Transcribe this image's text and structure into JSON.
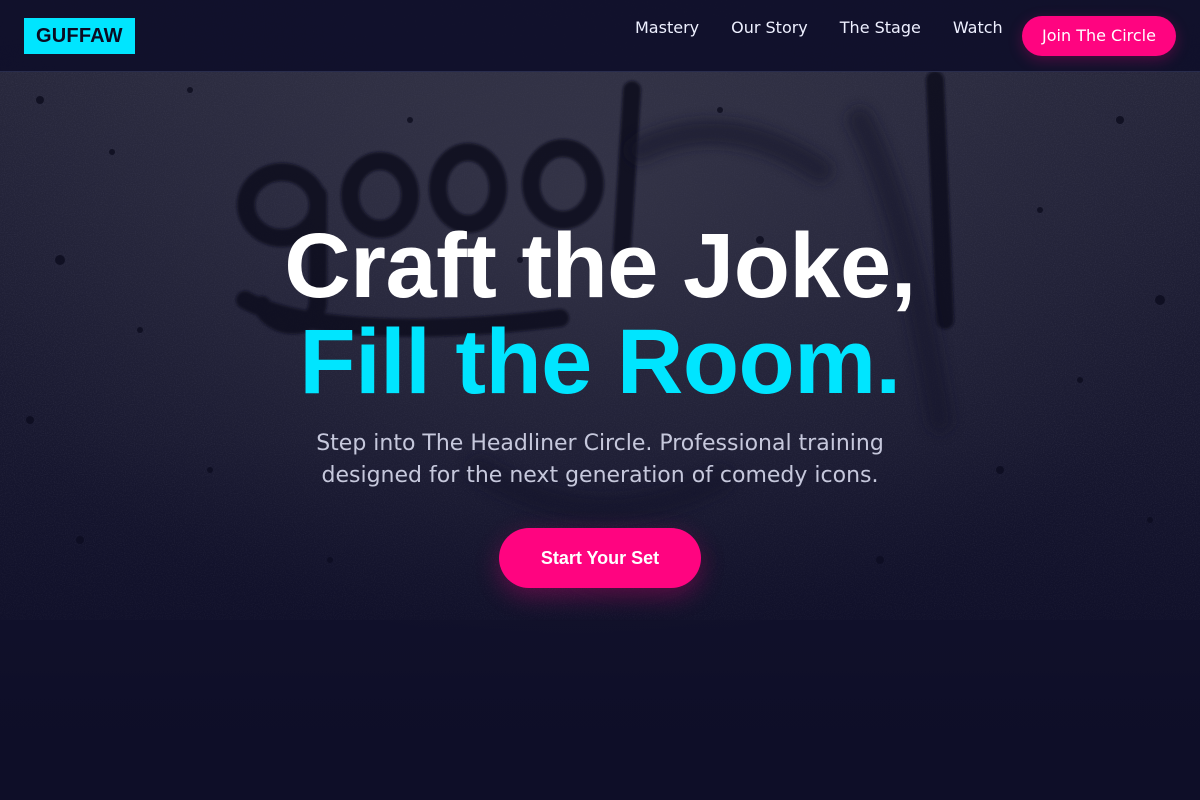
{
  "nav": {
    "logo": "GUFFAW",
    "links": [
      "Mastery",
      "Our Story",
      "The Stage",
      "Watch"
    ],
    "cta": "Join The Circle"
  },
  "hero": {
    "headline_line1": "Craft the Joke,",
    "headline_line2": "Fill the Room.",
    "subtitle": "Step into The Headliner Circle. Professional training designed for the next generation of comedy icons.",
    "cta": "Start Your Set",
    "background_image": "concrete-wall-graffiti-photo"
  },
  "colors": {
    "accent_cyan": "#00e5ff",
    "accent_pink": "#ff0480",
    "background_navy": "#0f0f29"
  }
}
